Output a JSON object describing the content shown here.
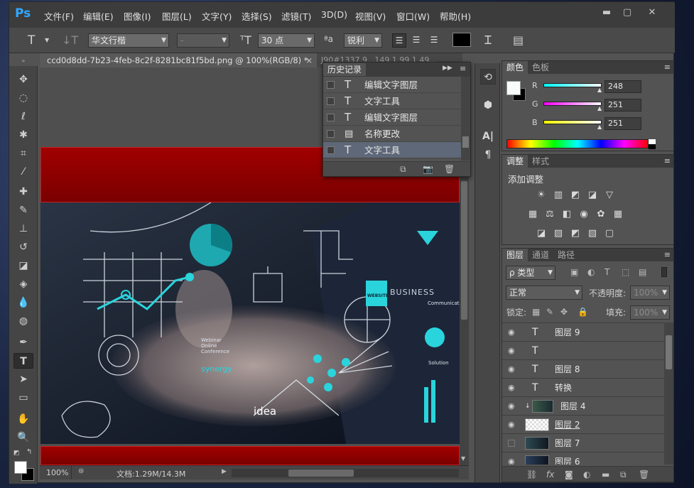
{
  "app": {
    "logo": "Ps"
  },
  "menu": [
    "文件(F)",
    "编辑(E)",
    "图像(I)",
    "图层(L)",
    "文字(Y)",
    "选择(S)",
    "滤镜(T)",
    "3D(D)",
    "视图(V)",
    "窗口(W)",
    "帮助(H)"
  ],
  "options": {
    "font_family": "华文行楷",
    "font_style": "-",
    "font_size": "30 点",
    "aa_label": "ªa",
    "antialias": "锐利",
    "color_hex": "#000000"
  },
  "document": {
    "tab_title": "ccd0d8dd-7b23-4feb-8c2f-8281bc81f5bd.png @ 100%(RGB/8) *",
    "close": "×",
    "second_tab": "J90#1337.9...149 1 99 1 49...",
    "zoom": "100%",
    "doc_info": "文档:1.29M/14.3M",
    "art_words": {
      "idea": "idea",
      "synergy": "synergy",
      "webinar": "Webinar\nOnline\nConference",
      "website": "WEBSITE",
      "business": "BUSINESS",
      "communication": "Communication",
      "solution": "Solution"
    }
  },
  "history": {
    "title": "历史记录",
    "items": [
      {
        "icon": "T",
        "label": "编辑文字图层"
      },
      {
        "icon": "T",
        "label": "文字工具"
      },
      {
        "icon": "T",
        "label": "编辑文字图层"
      },
      {
        "icon": "doc",
        "label": "名称更改"
      },
      {
        "icon": "T",
        "label": "文字工具"
      }
    ]
  },
  "color": {
    "tab_color": "颜色",
    "tab_swatches": "色板",
    "r_label": "R",
    "g_label": "G",
    "b_label": "B",
    "r": "248",
    "g": "251",
    "b": "251"
  },
  "adjust": {
    "tab_adjust": "调整",
    "tab_styles": "样式",
    "add_label": "添加调整"
  },
  "layers": {
    "tab_layers": "图层",
    "tab_channels": "通道",
    "tab_paths": "路径",
    "filter": "ρ 类型",
    "blend_mode": "正常",
    "opacity_label": "不透明度:",
    "opacity": "100%",
    "lock_label": "锁定:",
    "fill_label": "填充:",
    "fill": "100%",
    "items": [
      {
        "type": "text",
        "name": "图层 9"
      },
      {
        "type": "text",
        "name": ""
      },
      {
        "type": "text",
        "name": "图层 8"
      },
      {
        "type": "text",
        "name": "转换"
      },
      {
        "type": "image",
        "name": "图层 4"
      },
      {
        "type": "trans",
        "name": "图层 2"
      },
      {
        "type": "image",
        "name": "图层 7"
      },
      {
        "type": "image",
        "name": "图层 6"
      }
    ]
  },
  "colors": {
    "accent": "#31a8ff",
    "red_band": "#a10000",
    "fg": "#ffffff",
    "bg": "#000000"
  }
}
